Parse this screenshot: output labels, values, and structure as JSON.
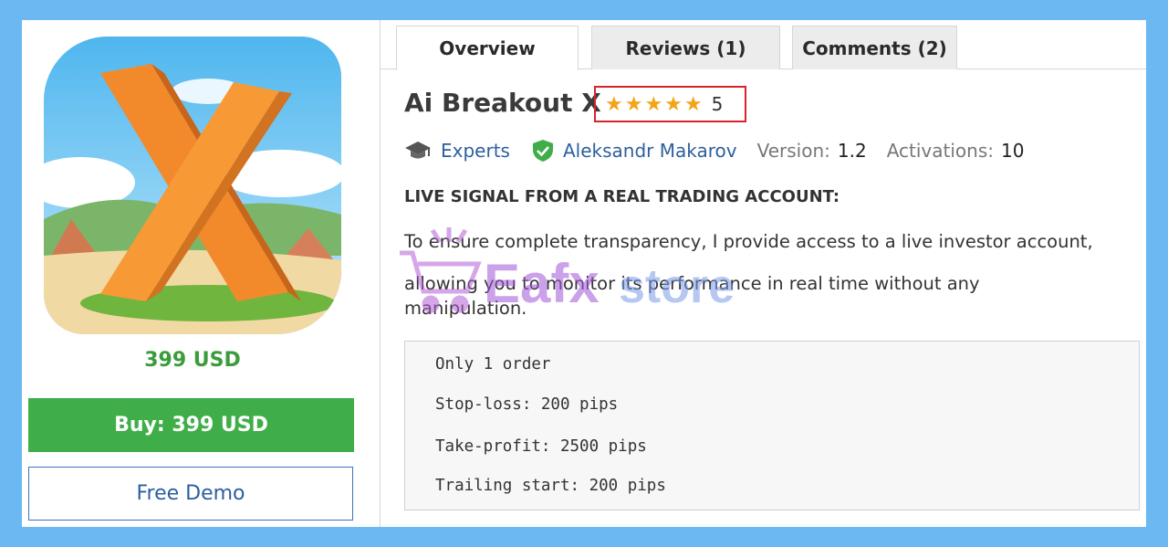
{
  "product": {
    "price_label": "399 USD",
    "buy_label": "Buy: 399 USD",
    "demo_label": "Free Demo"
  },
  "tabs": [
    {
      "label": "Overview",
      "active": true
    },
    {
      "label": "Reviews (1)",
      "active": false
    },
    {
      "label": "Comments (2)",
      "active": false
    }
  ],
  "title": "Ai Breakout X",
  "rating": {
    "stars": 5,
    "value": "5"
  },
  "meta": {
    "category": "Experts",
    "author": "Aleksandr Makarov",
    "version_label": "Version:",
    "version": "1.2",
    "activations_label": "Activations:",
    "activations": "10"
  },
  "description": {
    "heading": "LIVE SIGNAL FROM A REAL TRADING ACCOUNT:",
    "line1": "To ensure complete transparency, I provide access to a live investor account,",
    "line2": "allowing you to monitor its performance in real time without any",
    "line3": "manipulation."
  },
  "settings": [
    "Only 1 order",
    "Stop-loss: 200 pips",
    "Take-profit: 2500 pips",
    "Trailing start: 200 pips"
  ],
  "watermark": {
    "text_a": "Eafx",
    "text_b": "store"
  },
  "colors": {
    "background": "#6cb8f3",
    "price_green": "#3a9c3a",
    "buy_green": "#3fae49",
    "link_blue": "#2d5f9e",
    "star_gold": "#f3a51a",
    "highlight_red": "#d9232a"
  },
  "icons": {
    "category": "graduation-cap-icon",
    "author": "verified-shield-icon"
  }
}
